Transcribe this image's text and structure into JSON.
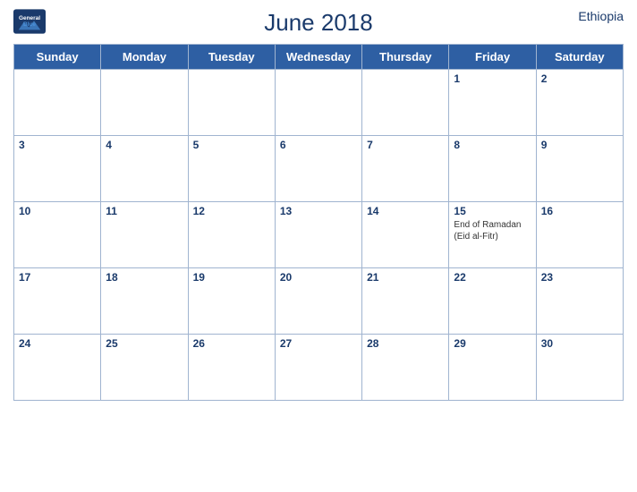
{
  "header": {
    "title": "June 2018",
    "country": "Ethiopia",
    "logo_line1": "General",
    "logo_line2": "Blue"
  },
  "weekdays": [
    "Sunday",
    "Monday",
    "Tuesday",
    "Wednesday",
    "Thursday",
    "Friday",
    "Saturday"
  ],
  "weeks": [
    [
      {
        "day": "",
        "empty": true
      },
      {
        "day": "",
        "empty": true
      },
      {
        "day": "",
        "empty": true
      },
      {
        "day": "",
        "empty": true
      },
      {
        "day": "",
        "empty": true
      },
      {
        "day": "1",
        "empty": false,
        "event": ""
      },
      {
        "day": "2",
        "empty": false,
        "event": ""
      }
    ],
    [
      {
        "day": "3",
        "empty": false,
        "event": ""
      },
      {
        "day": "4",
        "empty": false,
        "event": ""
      },
      {
        "day": "5",
        "empty": false,
        "event": ""
      },
      {
        "day": "6",
        "empty": false,
        "event": ""
      },
      {
        "day": "7",
        "empty": false,
        "event": ""
      },
      {
        "day": "8",
        "empty": false,
        "event": ""
      },
      {
        "day": "9",
        "empty": false,
        "event": ""
      }
    ],
    [
      {
        "day": "10",
        "empty": false,
        "event": ""
      },
      {
        "day": "11",
        "empty": false,
        "event": ""
      },
      {
        "day": "12",
        "empty": false,
        "event": ""
      },
      {
        "day": "13",
        "empty": false,
        "event": ""
      },
      {
        "day": "14",
        "empty": false,
        "event": ""
      },
      {
        "day": "15",
        "empty": false,
        "event": "End of Ramadan (Eid al-Fitr)"
      },
      {
        "day": "16",
        "empty": false,
        "event": ""
      }
    ],
    [
      {
        "day": "17",
        "empty": false,
        "event": ""
      },
      {
        "day": "18",
        "empty": false,
        "event": ""
      },
      {
        "day": "19",
        "empty": false,
        "event": ""
      },
      {
        "day": "20",
        "empty": false,
        "event": ""
      },
      {
        "day": "21",
        "empty": false,
        "event": ""
      },
      {
        "day": "22",
        "empty": false,
        "event": ""
      },
      {
        "day": "23",
        "empty": false,
        "event": ""
      }
    ],
    [
      {
        "day": "24",
        "empty": false,
        "event": ""
      },
      {
        "day": "25",
        "empty": false,
        "event": ""
      },
      {
        "day": "26",
        "empty": false,
        "event": ""
      },
      {
        "day": "27",
        "empty": false,
        "event": ""
      },
      {
        "day": "28",
        "empty": false,
        "event": ""
      },
      {
        "day": "29",
        "empty": false,
        "event": ""
      },
      {
        "day": "30",
        "empty": false,
        "event": ""
      }
    ]
  ]
}
